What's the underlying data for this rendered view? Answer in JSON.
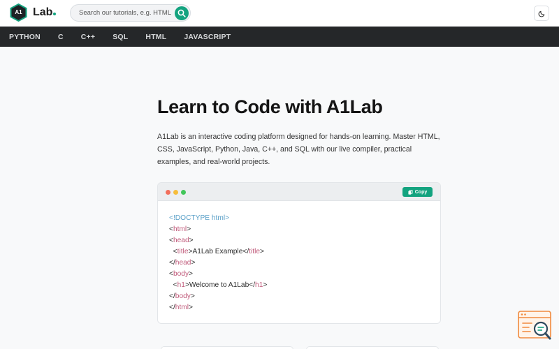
{
  "header": {
    "logo_badge": "A1",
    "logo_text": "Lab",
    "search_placeholder": "Search our tutorials, e.g. HTML"
  },
  "nav": {
    "items": [
      "PYTHON",
      "C",
      "C++",
      "SQL",
      "HTML",
      "JAVASCRIPT"
    ]
  },
  "hero": {
    "title": "Learn to Code with A1Lab",
    "description": "A1Lab is an interactive coding platform designed for hands-on learning. Master HTML, CSS, JavaScript, Python, Java, C++, and SQL with our live compiler, practical examples, and real-world projects."
  },
  "code_card": {
    "copy_label": "Copy",
    "lines": [
      {
        "indent": "",
        "open": "<!",
        "name": "DOCTYPE html",
        "close": ">",
        "text": "",
        "end_open": "",
        "end_name": "",
        "end_close": "",
        "kind": "doctype"
      },
      {
        "indent": "",
        "open": "<",
        "name": "html",
        "close": ">",
        "text": "",
        "end_open": "",
        "end_name": "",
        "end_close": "",
        "kind": "tag"
      },
      {
        "indent": "",
        "open": "<",
        "name": "head",
        "close": ">",
        "text": "",
        "end_open": "",
        "end_name": "",
        "end_close": "",
        "kind": "tag"
      },
      {
        "indent": "  ",
        "open": "<",
        "name": "title",
        "close": ">",
        "text": "A1Lab Example",
        "end_open": "</",
        "end_name": "title",
        "end_close": ">",
        "kind": "tag"
      },
      {
        "indent": "",
        "open": "</",
        "name": "head",
        "close": ">",
        "text": "",
        "end_open": "",
        "end_name": "",
        "end_close": "",
        "kind": "tag"
      },
      {
        "indent": "",
        "open": "<",
        "name": "body",
        "close": ">",
        "text": "",
        "end_open": "",
        "end_name": "",
        "end_close": "",
        "kind": "tag"
      },
      {
        "indent": "  ",
        "open": "<",
        "name": "h1",
        "close": ">",
        "text": "Welcome to A1Lab",
        "end_open": "</",
        "end_name": "h1",
        "end_close": ">",
        "kind": "tag"
      },
      {
        "indent": "",
        "open": "</",
        "name": "body",
        "close": ">",
        "text": "",
        "end_open": "",
        "end_name": "",
        "end_close": "",
        "kind": "tag"
      },
      {
        "indent": "",
        "open": "</",
        "name": "html",
        "close": ">",
        "text": "",
        "end_open": "",
        "end_name": "",
        "end_close": "",
        "kind": "tag"
      }
    ]
  },
  "colors": {
    "brand": "#13a37f",
    "nav_bg": "#252729",
    "tag": "#c05a7a",
    "doctype": "#5aa0c8"
  },
  "icons": {
    "logo": "hexagon-logo-icon",
    "search": "search-icon",
    "theme": "moon-icon",
    "copy": "copy-icon",
    "widget": "browser-search-icon"
  }
}
